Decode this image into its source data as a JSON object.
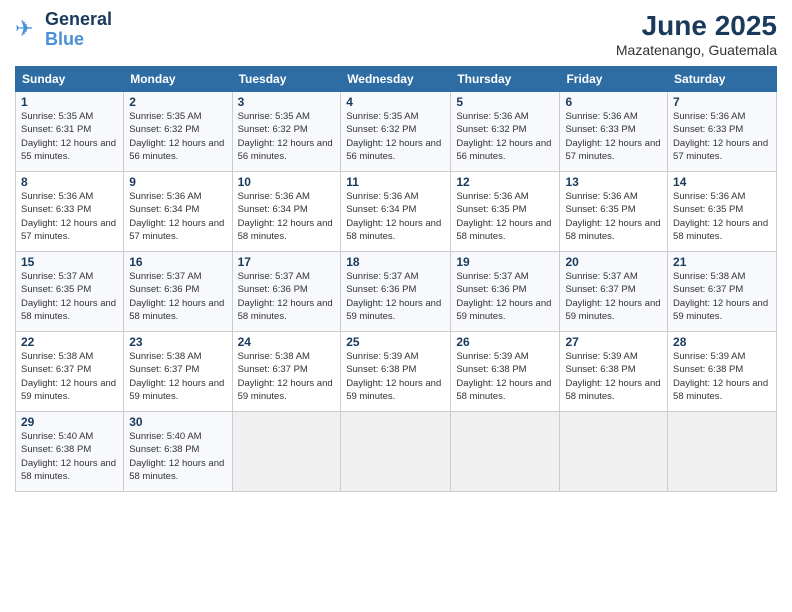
{
  "header": {
    "logo_line1": "General",
    "logo_line2": "Blue",
    "month": "June 2025",
    "location": "Mazatenango, Guatemala"
  },
  "days_of_week": [
    "Sunday",
    "Monday",
    "Tuesday",
    "Wednesday",
    "Thursday",
    "Friday",
    "Saturday"
  ],
  "weeks": [
    [
      {
        "day": "1",
        "sunrise": "5:35 AM",
        "sunset": "6:31 PM",
        "daylight": "12 hours and 55 minutes."
      },
      {
        "day": "2",
        "sunrise": "5:35 AM",
        "sunset": "6:32 PM",
        "daylight": "12 hours and 56 minutes."
      },
      {
        "day": "3",
        "sunrise": "5:35 AM",
        "sunset": "6:32 PM",
        "daylight": "12 hours and 56 minutes."
      },
      {
        "day": "4",
        "sunrise": "5:35 AM",
        "sunset": "6:32 PM",
        "daylight": "12 hours and 56 minutes."
      },
      {
        "day": "5",
        "sunrise": "5:36 AM",
        "sunset": "6:32 PM",
        "daylight": "12 hours and 56 minutes."
      },
      {
        "day": "6",
        "sunrise": "5:36 AM",
        "sunset": "6:33 PM",
        "daylight": "12 hours and 57 minutes."
      },
      {
        "day": "7",
        "sunrise": "5:36 AM",
        "sunset": "6:33 PM",
        "daylight": "12 hours and 57 minutes."
      }
    ],
    [
      {
        "day": "8",
        "sunrise": "5:36 AM",
        "sunset": "6:33 PM",
        "daylight": "12 hours and 57 minutes."
      },
      {
        "day": "9",
        "sunrise": "5:36 AM",
        "sunset": "6:34 PM",
        "daylight": "12 hours and 57 minutes."
      },
      {
        "day": "10",
        "sunrise": "5:36 AM",
        "sunset": "6:34 PM",
        "daylight": "12 hours and 58 minutes."
      },
      {
        "day": "11",
        "sunrise": "5:36 AM",
        "sunset": "6:34 PM",
        "daylight": "12 hours and 58 minutes."
      },
      {
        "day": "12",
        "sunrise": "5:36 AM",
        "sunset": "6:35 PM",
        "daylight": "12 hours and 58 minutes."
      },
      {
        "day": "13",
        "sunrise": "5:36 AM",
        "sunset": "6:35 PM",
        "daylight": "12 hours and 58 minutes."
      },
      {
        "day": "14",
        "sunrise": "5:36 AM",
        "sunset": "6:35 PM",
        "daylight": "12 hours and 58 minutes."
      }
    ],
    [
      {
        "day": "15",
        "sunrise": "5:37 AM",
        "sunset": "6:35 PM",
        "daylight": "12 hours and 58 minutes."
      },
      {
        "day": "16",
        "sunrise": "5:37 AM",
        "sunset": "6:36 PM",
        "daylight": "12 hours and 58 minutes."
      },
      {
        "day": "17",
        "sunrise": "5:37 AM",
        "sunset": "6:36 PM",
        "daylight": "12 hours and 58 minutes."
      },
      {
        "day": "18",
        "sunrise": "5:37 AM",
        "sunset": "6:36 PM",
        "daylight": "12 hours and 59 minutes."
      },
      {
        "day": "19",
        "sunrise": "5:37 AM",
        "sunset": "6:36 PM",
        "daylight": "12 hours and 59 minutes."
      },
      {
        "day": "20",
        "sunrise": "5:37 AM",
        "sunset": "6:37 PM",
        "daylight": "12 hours and 59 minutes."
      },
      {
        "day": "21",
        "sunrise": "5:38 AM",
        "sunset": "6:37 PM",
        "daylight": "12 hours and 59 minutes."
      }
    ],
    [
      {
        "day": "22",
        "sunrise": "5:38 AM",
        "sunset": "6:37 PM",
        "daylight": "12 hours and 59 minutes."
      },
      {
        "day": "23",
        "sunrise": "5:38 AM",
        "sunset": "6:37 PM",
        "daylight": "12 hours and 59 minutes."
      },
      {
        "day": "24",
        "sunrise": "5:38 AM",
        "sunset": "6:37 PM",
        "daylight": "12 hours and 59 minutes."
      },
      {
        "day": "25",
        "sunrise": "5:39 AM",
        "sunset": "6:38 PM",
        "daylight": "12 hours and 59 minutes."
      },
      {
        "day": "26",
        "sunrise": "5:39 AM",
        "sunset": "6:38 PM",
        "daylight": "12 hours and 58 minutes."
      },
      {
        "day": "27",
        "sunrise": "5:39 AM",
        "sunset": "6:38 PM",
        "daylight": "12 hours and 58 minutes."
      },
      {
        "day": "28",
        "sunrise": "5:39 AM",
        "sunset": "6:38 PM",
        "daylight": "12 hours and 58 minutes."
      }
    ],
    [
      {
        "day": "29",
        "sunrise": "5:40 AM",
        "sunset": "6:38 PM",
        "daylight": "12 hours and 58 minutes."
      },
      {
        "day": "30",
        "sunrise": "5:40 AM",
        "sunset": "6:38 PM",
        "daylight": "12 hours and 58 minutes."
      },
      null,
      null,
      null,
      null,
      null
    ]
  ]
}
